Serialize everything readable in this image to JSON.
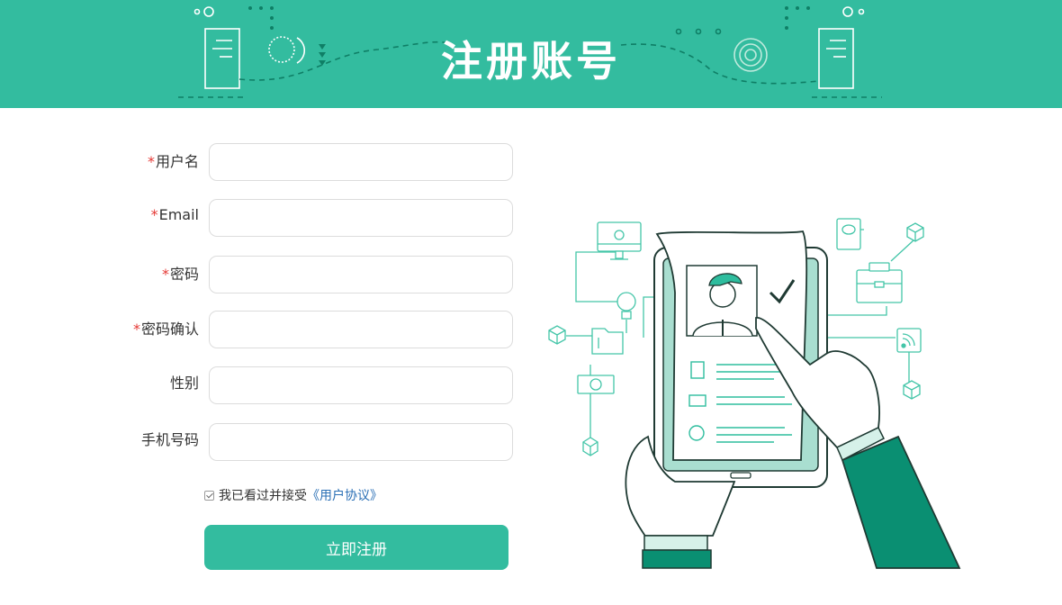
{
  "header": {
    "title": "注册账号"
  },
  "form": {
    "fields": [
      {
        "label": "用户名",
        "required": "*",
        "value": ""
      },
      {
        "label": "Email",
        "required": "*",
        "value": ""
      },
      {
        "label": "密码",
        "required": "*",
        "value": ""
      },
      {
        "label": "密码确认",
        "required": "*",
        "value": ""
      },
      {
        "label": "性别",
        "required": "",
        "value": ""
      },
      {
        "label": "手机号码",
        "required": "",
        "value": ""
      }
    ],
    "agreement": {
      "text": "我已看过并接受",
      "link": "《用户协议》",
      "checked": true
    },
    "submit_label": "立即注册"
  },
  "colors": {
    "brand": "#33bc9f",
    "brand_dark": "#0a8f72",
    "required": "#e53935",
    "link": "#2a6fb5"
  },
  "illustration": {
    "icon_names": [
      "monitor-icon",
      "lightbulb-icon",
      "folder-icon",
      "money-icon",
      "cube-icon",
      "book-icon",
      "briefcase-icon",
      "rss-icon",
      "phone-icon",
      "profile-card-icon",
      "checkmark-icon",
      "hand-icon"
    ]
  }
}
